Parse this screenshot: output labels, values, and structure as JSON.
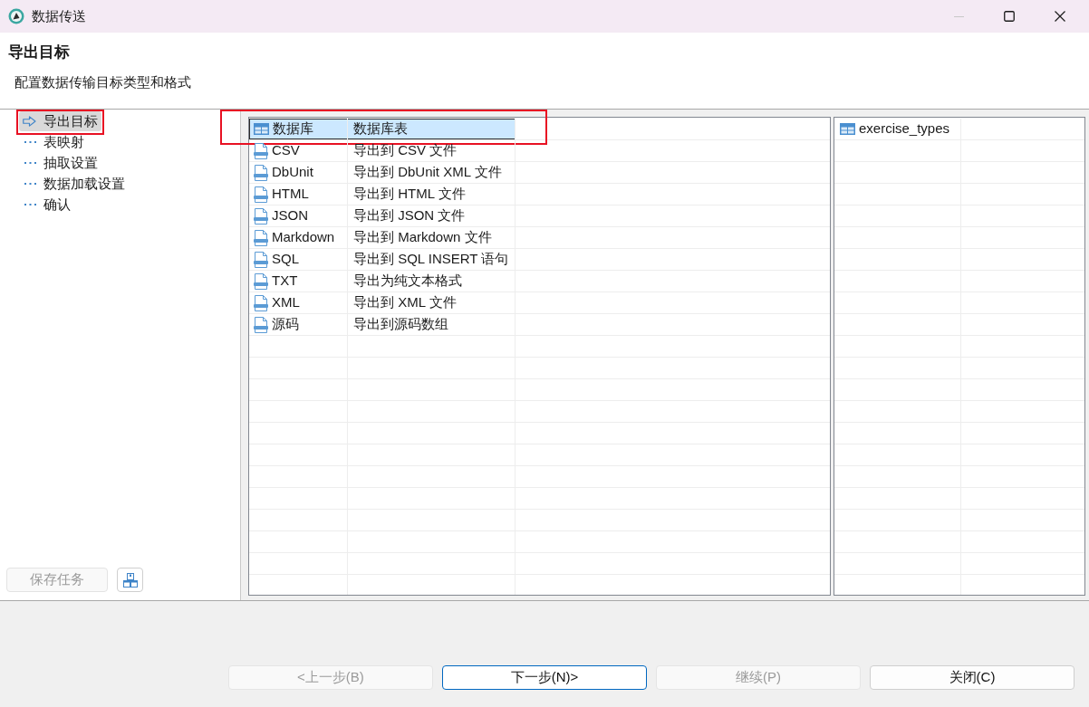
{
  "window": {
    "title": "数据传送",
    "controls": [
      {
        "kind": "minimize",
        "disabled": true
      },
      {
        "kind": "maximize",
        "disabled": false
      },
      {
        "kind": "close",
        "disabled": false
      }
    ]
  },
  "header": {
    "title": "导出目标",
    "subtitle": "配置数据传输目标类型和格式"
  },
  "steps": [
    {
      "label": "导出目标",
      "selected": true,
      "highlighted": true
    },
    {
      "label": "表映射",
      "selected": false,
      "highlighted": false
    },
    {
      "label": "抽取设置",
      "selected": false,
      "highlighted": false
    },
    {
      "label": "数据加载设置",
      "selected": false,
      "highlighted": false
    },
    {
      "label": "确认",
      "selected": false,
      "highlighted": false
    }
  ],
  "save_task_button": {
    "label": "保存任务",
    "disabled": true
  },
  "targets": {
    "rows": [
      {
        "kind": "table",
        "name": "数据库",
        "description": "数据库表",
        "selected": true,
        "highlighted": true
      },
      {
        "kind": "file",
        "name": "CSV",
        "description": "导出到 CSV 文件",
        "selected": false,
        "highlighted": false
      },
      {
        "kind": "file",
        "name": "DbUnit",
        "description": "导出到 DbUnit XML 文件",
        "selected": false,
        "highlighted": false
      },
      {
        "kind": "file",
        "name": "HTML",
        "description": "导出到 HTML 文件",
        "selected": false,
        "highlighted": false
      },
      {
        "kind": "file",
        "name": "JSON",
        "description": "导出到 JSON 文件",
        "selected": false,
        "highlighted": false
      },
      {
        "kind": "file",
        "name": "Markdown",
        "description": "导出到 Markdown 文件",
        "selected": false,
        "highlighted": false
      },
      {
        "kind": "file",
        "name": "SQL",
        "description": "导出到 SQL INSERT 语句",
        "selected": false,
        "highlighted": false
      },
      {
        "kind": "file",
        "name": "TXT",
        "description": "导出为纯文本格式",
        "selected": false,
        "highlighted": false
      },
      {
        "kind": "file",
        "name": "XML",
        "description": "导出到 XML 文件",
        "selected": false,
        "highlighted": false
      },
      {
        "kind": "file",
        "name": "源码",
        "description": "导出到源码数组",
        "selected": false,
        "highlighted": false
      }
    ]
  },
  "tables": {
    "rows": [
      {
        "name": "exercise_types"
      }
    ]
  },
  "buttons": [
    {
      "label": "<上一步(B)",
      "disabled": true,
      "default": false
    },
    {
      "label": "下一步(N)>",
      "disabled": false,
      "default": true
    },
    {
      "label": "继续(P)",
      "disabled": true,
      "default": false
    },
    {
      "label": "关闭(C)",
      "disabled": false,
      "default": false
    }
  ]
}
